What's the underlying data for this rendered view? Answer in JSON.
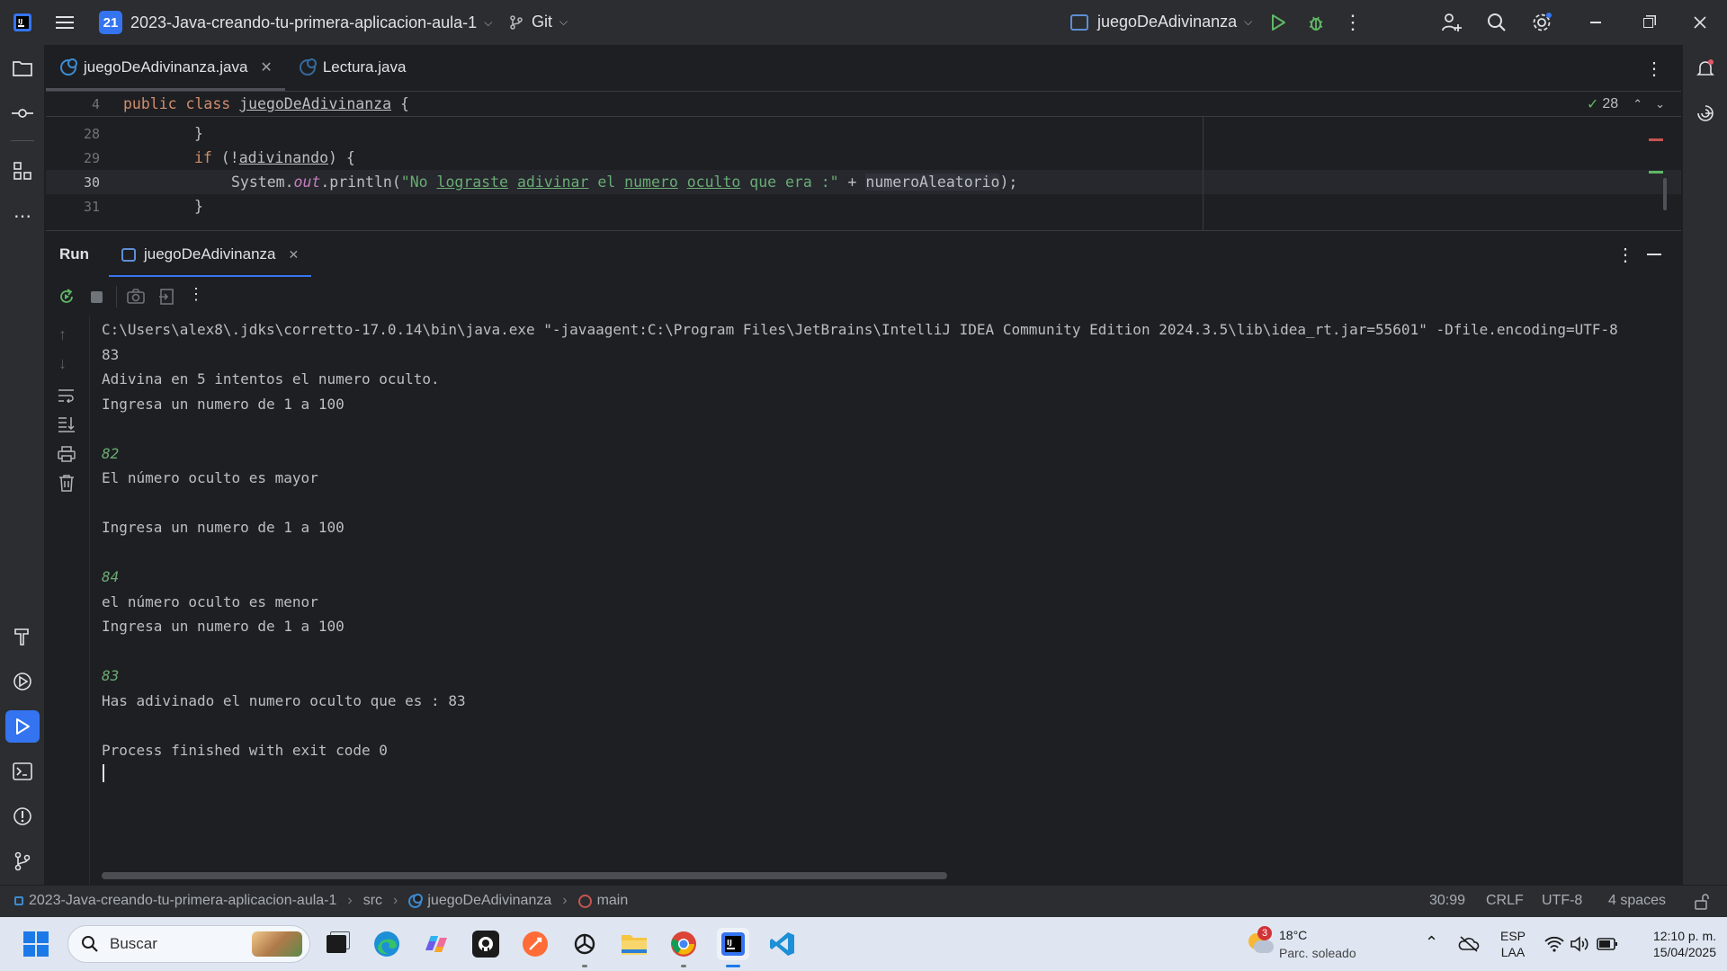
{
  "titlebar": {
    "project_badge": "21",
    "project_name": "2023-Java-creando-tu-primera-aplicacion-aula-1",
    "vcs": "Git",
    "run_config": "juegoDeAdivinanza"
  },
  "editor": {
    "tabs": [
      {
        "label": "juegoDeAdivinanza.java"
      },
      {
        "label": "Lectura.java"
      }
    ],
    "inspections_count": "28",
    "sticky_line": {
      "number": "4",
      "text_kw": "public class ",
      "text_name": "juegoDeAdivinanza",
      "text_end": " {"
    },
    "lines": [
      {
        "number": "28"
      },
      {
        "number": "29"
      },
      {
        "number": "30"
      },
      {
        "number": "31"
      }
    ],
    "line28": "}",
    "line29_kw": "if",
    "line29_rest": " (!",
    "line29_var": "adivinando",
    "line29_end": ") {",
    "line30_a": "System.",
    "line30_field": "out",
    "line30_b": ".println(",
    "line30_str1": "\"No ",
    "line30_w1": "lograste",
    "line30_s2": " ",
    "line30_w2": "adivinar",
    "line30_s3": " el ",
    "line30_w3": "numero",
    "line30_s4": " ",
    "line30_w4": "oculto",
    "line30_s5": " que era :\"",
    "line30_c": " + ",
    "line30_var": "numeroAleatorio",
    "line30_end": ");",
    "line31": "}"
  },
  "run": {
    "title": "Run",
    "tab_label": "juegoDeAdivinanza",
    "console": [
      {
        "text": "C:\\Users\\alex8\\.jdks\\corretto-17.0.14\\bin\\java.exe \"-javaagent:C:\\Program Files\\JetBrains\\IntelliJ IDEA Community Edition 2024.3.5\\lib\\idea_rt.jar=55601\" -Dfile.encoding=UTF-8",
        "input": false
      },
      {
        "text": "83",
        "input": false
      },
      {
        "text": "Adivina en 5 intentos el numero oculto.",
        "input": false
      },
      {
        "text": "Ingresa un numero de 1 a 100",
        "input": false
      },
      {
        "text": "",
        "input": false
      },
      {
        "text": "82",
        "input": true
      },
      {
        "text": "El número oculto es mayor",
        "input": false
      },
      {
        "text": "",
        "input": false
      },
      {
        "text": "Ingresa un numero de 1 a 100",
        "input": false
      },
      {
        "text": "",
        "input": false
      },
      {
        "text": "84",
        "input": true
      },
      {
        "text": "el número oculto es menor",
        "input": false
      },
      {
        "text": "Ingresa un numero de 1 a 100",
        "input": false
      },
      {
        "text": "",
        "input": false
      },
      {
        "text": "83",
        "input": true
      },
      {
        "text": "Has adivinado el numero oculto que es : 83",
        "input": false
      },
      {
        "text": "",
        "input": false
      },
      {
        "text": "Process finished with exit code 0",
        "input": false
      }
    ]
  },
  "statusbar": {
    "breadcrumb": [
      "2023-Java-creando-tu-primera-aplicacion-aula-1",
      "src",
      "juegoDeAdivinanza",
      "main"
    ],
    "position": "30:99",
    "line_sep": "CRLF",
    "encoding": "UTF-8",
    "indent": "4 spaces"
  },
  "taskbar": {
    "search_placeholder": "Buscar",
    "weather_badge": "3",
    "weather_temp": "18°C",
    "weather_desc": "Parc. soleado",
    "lang_top": "ESP",
    "lang_bottom": "LAA",
    "time": "12:10 p. m.",
    "date": "15/04/2025"
  },
  "colors": {
    "accent": "#3574f0",
    "run_green": "#5fb865",
    "string_green": "#6aab73",
    "keyword": "#cf8e6d"
  }
}
